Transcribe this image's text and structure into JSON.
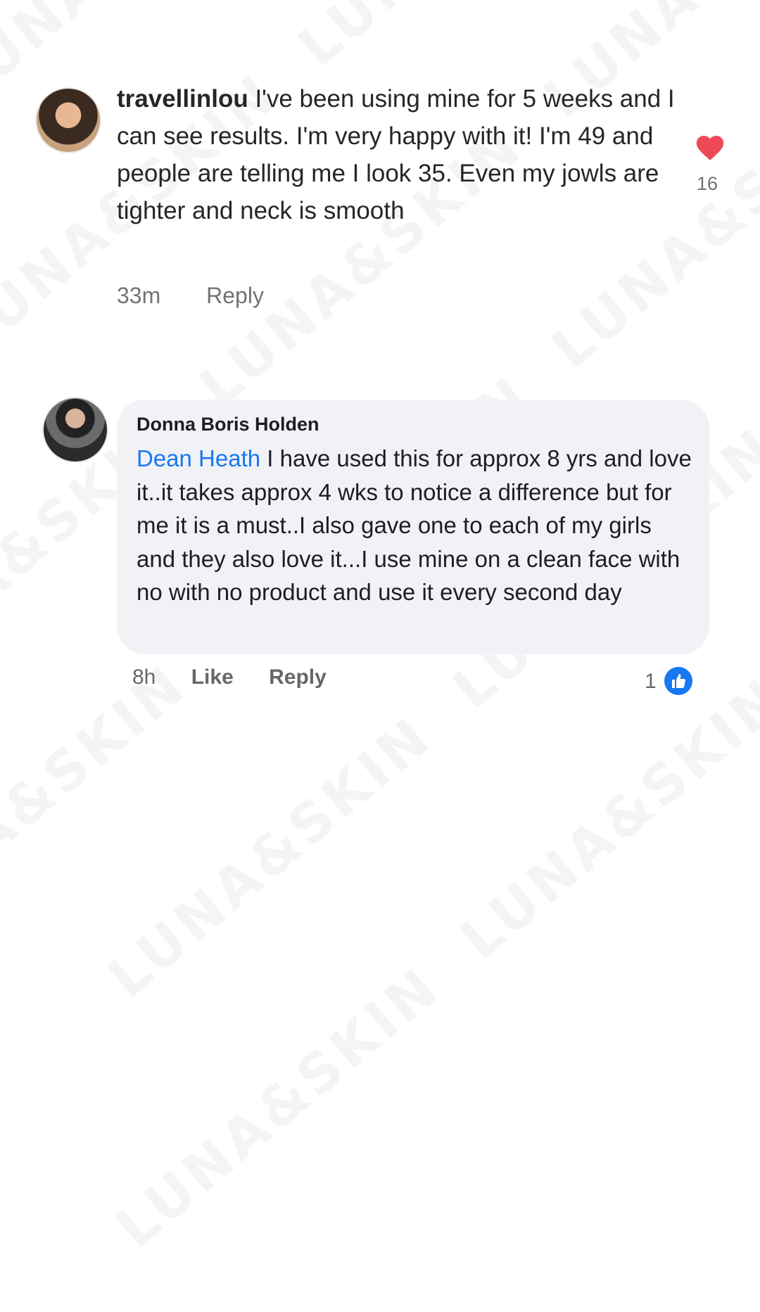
{
  "watermark": {
    "text": "LUNA&SKIN"
  },
  "comment1": {
    "username": "travellinlou",
    "text": "I've been using mine for 5 weeks and I can see results. I'm very happy with it! I'm 49 and people are telling me I look 35. Even my jowls are tighter and neck is smooth",
    "time": "33m",
    "reply_label": "Reply",
    "like_count": "16",
    "heart_color": "#ed4956",
    "icon": "heart-icon"
  },
  "comment2": {
    "author": "Donna Boris Holden",
    "mention": "Dean Heath",
    "text": "I have used this for approx 8 yrs and love it..it takes approx 4 wks to notice a difference but for me it is a must..I also gave one to each of my girls and they also love it...I use mine on a clean face with no with no product and use it every second day",
    "time": "8h",
    "like_label": "Like",
    "reply_label": "Reply",
    "reaction_count": "1",
    "reaction_color": "#1877f2",
    "icon": "thumbs-up-icon"
  }
}
